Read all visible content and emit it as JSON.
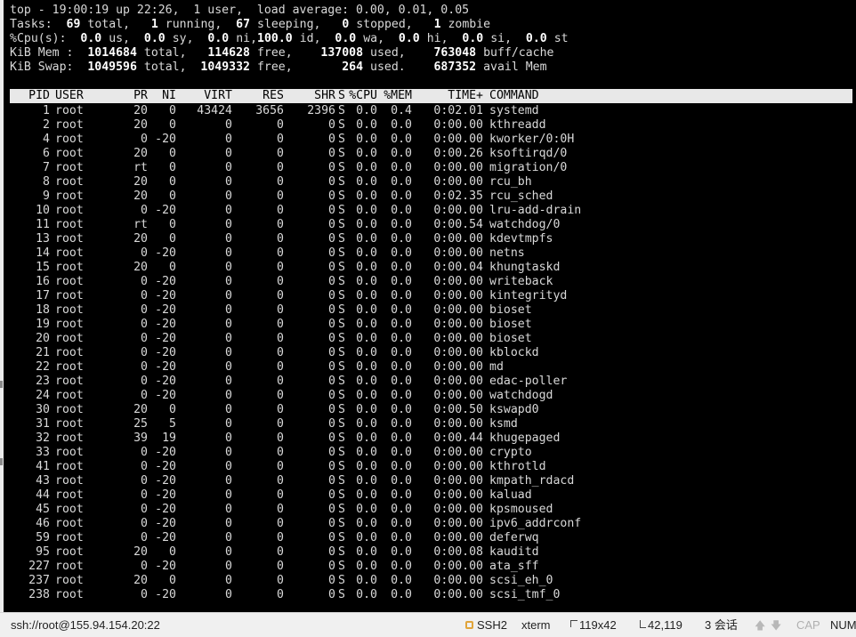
{
  "summary": {
    "line1": "top - 19:00:19 up 22:26,  1 user,  load average: 0.00, 0.01, 0.05",
    "tasks": {
      "label": "Tasks:",
      "total": "69",
      "total_l": "total,",
      "running": "1",
      "running_l": "running,",
      "sleeping": "67",
      "sleeping_l": "sleeping,",
      "stopped": "0",
      "stopped_l": "stopped,",
      "zombie": "1",
      "zombie_l": "zombie"
    },
    "cpu": {
      "label": "%Cpu(s):",
      "us": "0.0",
      "us_l": "us,",
      "sy": "0.0",
      "sy_l": "sy,",
      "ni": "0.0",
      "ni_l": "ni,",
      "id": "100.0",
      "id_l": "id,",
      "wa": "0.0",
      "wa_l": "wa,",
      "hi": "0.0",
      "hi_l": "hi,",
      "si": "0.0",
      "si_l": "si,",
      "st": "0.0",
      "st_l": "st"
    },
    "mem": {
      "label": "KiB Mem :",
      "total": "1014684",
      "total_l": "total,",
      "free": "114628",
      "free_l": "free,",
      "used": "137008",
      "used_l": "used,",
      "buff": "763048",
      "buff_l": "buff/cache"
    },
    "swap": {
      "label": "KiB Swap:",
      "total": "1049596",
      "total_l": "total,",
      "free": "1049332",
      "free_l": "free,",
      "used": "264",
      "used_l": "used.",
      "avail": "687352",
      "avail_l": "avail Mem"
    }
  },
  "columns": {
    "pid": "PID",
    "user": "USER",
    "pr": "PR",
    "ni": "NI",
    "virt": "VIRT",
    "res": "RES",
    "shr": "SHR",
    "s": "S",
    "cpu": "%CPU",
    "mem": "%MEM",
    "time": "TIME+",
    "cmd": "COMMAND"
  },
  "processes": [
    {
      "pid": "1",
      "user": "root",
      "pr": "20",
      "ni": "0",
      "virt": "43424",
      "res": "3656",
      "shr": "2396",
      "s": "S",
      "cpu": "0.0",
      "mem": "0.4",
      "time": "0:02.01",
      "cmd": "systemd"
    },
    {
      "pid": "2",
      "user": "root",
      "pr": "20",
      "ni": "0",
      "virt": "0",
      "res": "0",
      "shr": "0",
      "s": "S",
      "cpu": "0.0",
      "mem": "0.0",
      "time": "0:00.00",
      "cmd": "kthreadd"
    },
    {
      "pid": "4",
      "user": "root",
      "pr": "0",
      "ni": "-20",
      "virt": "0",
      "res": "0",
      "shr": "0",
      "s": "S",
      "cpu": "0.0",
      "mem": "0.0",
      "time": "0:00.00",
      "cmd": "kworker/0:0H"
    },
    {
      "pid": "6",
      "user": "root",
      "pr": "20",
      "ni": "0",
      "virt": "0",
      "res": "0",
      "shr": "0",
      "s": "S",
      "cpu": "0.0",
      "mem": "0.0",
      "time": "0:00.26",
      "cmd": "ksoftirqd/0"
    },
    {
      "pid": "7",
      "user": "root",
      "pr": "rt",
      "ni": "0",
      "virt": "0",
      "res": "0",
      "shr": "0",
      "s": "S",
      "cpu": "0.0",
      "mem": "0.0",
      "time": "0:00.00",
      "cmd": "migration/0"
    },
    {
      "pid": "8",
      "user": "root",
      "pr": "20",
      "ni": "0",
      "virt": "0",
      "res": "0",
      "shr": "0",
      "s": "S",
      "cpu": "0.0",
      "mem": "0.0",
      "time": "0:00.00",
      "cmd": "rcu_bh"
    },
    {
      "pid": "9",
      "user": "root",
      "pr": "20",
      "ni": "0",
      "virt": "0",
      "res": "0",
      "shr": "0",
      "s": "S",
      "cpu": "0.0",
      "mem": "0.0",
      "time": "0:02.35",
      "cmd": "rcu_sched"
    },
    {
      "pid": "10",
      "user": "root",
      "pr": "0",
      "ni": "-20",
      "virt": "0",
      "res": "0",
      "shr": "0",
      "s": "S",
      "cpu": "0.0",
      "mem": "0.0",
      "time": "0:00.00",
      "cmd": "lru-add-drain"
    },
    {
      "pid": "11",
      "user": "root",
      "pr": "rt",
      "ni": "0",
      "virt": "0",
      "res": "0",
      "shr": "0",
      "s": "S",
      "cpu": "0.0",
      "mem": "0.0",
      "time": "0:00.54",
      "cmd": "watchdog/0"
    },
    {
      "pid": "13",
      "user": "root",
      "pr": "20",
      "ni": "0",
      "virt": "0",
      "res": "0",
      "shr": "0",
      "s": "S",
      "cpu": "0.0",
      "mem": "0.0",
      "time": "0:00.00",
      "cmd": "kdevtmpfs"
    },
    {
      "pid": "14",
      "user": "root",
      "pr": "0",
      "ni": "-20",
      "virt": "0",
      "res": "0",
      "shr": "0",
      "s": "S",
      "cpu": "0.0",
      "mem": "0.0",
      "time": "0:00.00",
      "cmd": "netns"
    },
    {
      "pid": "15",
      "user": "root",
      "pr": "20",
      "ni": "0",
      "virt": "0",
      "res": "0",
      "shr": "0",
      "s": "S",
      "cpu": "0.0",
      "mem": "0.0",
      "time": "0:00.04",
      "cmd": "khungtaskd"
    },
    {
      "pid": "16",
      "user": "root",
      "pr": "0",
      "ni": "-20",
      "virt": "0",
      "res": "0",
      "shr": "0",
      "s": "S",
      "cpu": "0.0",
      "mem": "0.0",
      "time": "0:00.00",
      "cmd": "writeback"
    },
    {
      "pid": "17",
      "user": "root",
      "pr": "0",
      "ni": "-20",
      "virt": "0",
      "res": "0",
      "shr": "0",
      "s": "S",
      "cpu": "0.0",
      "mem": "0.0",
      "time": "0:00.00",
      "cmd": "kintegrityd"
    },
    {
      "pid": "18",
      "user": "root",
      "pr": "0",
      "ni": "-20",
      "virt": "0",
      "res": "0",
      "shr": "0",
      "s": "S",
      "cpu": "0.0",
      "mem": "0.0",
      "time": "0:00.00",
      "cmd": "bioset"
    },
    {
      "pid": "19",
      "user": "root",
      "pr": "0",
      "ni": "-20",
      "virt": "0",
      "res": "0",
      "shr": "0",
      "s": "S",
      "cpu": "0.0",
      "mem": "0.0",
      "time": "0:00.00",
      "cmd": "bioset"
    },
    {
      "pid": "20",
      "user": "root",
      "pr": "0",
      "ni": "-20",
      "virt": "0",
      "res": "0",
      "shr": "0",
      "s": "S",
      "cpu": "0.0",
      "mem": "0.0",
      "time": "0:00.00",
      "cmd": "bioset"
    },
    {
      "pid": "21",
      "user": "root",
      "pr": "0",
      "ni": "-20",
      "virt": "0",
      "res": "0",
      "shr": "0",
      "s": "S",
      "cpu": "0.0",
      "mem": "0.0",
      "time": "0:00.00",
      "cmd": "kblockd"
    },
    {
      "pid": "22",
      "user": "root",
      "pr": "0",
      "ni": "-20",
      "virt": "0",
      "res": "0",
      "shr": "0",
      "s": "S",
      "cpu": "0.0",
      "mem": "0.0",
      "time": "0:00.00",
      "cmd": "md"
    },
    {
      "pid": "23",
      "user": "root",
      "pr": "0",
      "ni": "-20",
      "virt": "0",
      "res": "0",
      "shr": "0",
      "s": "S",
      "cpu": "0.0",
      "mem": "0.0",
      "time": "0:00.00",
      "cmd": "edac-poller"
    },
    {
      "pid": "24",
      "user": "root",
      "pr": "0",
      "ni": "-20",
      "virt": "0",
      "res": "0",
      "shr": "0",
      "s": "S",
      "cpu": "0.0",
      "mem": "0.0",
      "time": "0:00.00",
      "cmd": "watchdogd"
    },
    {
      "pid": "30",
      "user": "root",
      "pr": "20",
      "ni": "0",
      "virt": "0",
      "res": "0",
      "shr": "0",
      "s": "S",
      "cpu": "0.0",
      "mem": "0.0",
      "time": "0:00.50",
      "cmd": "kswapd0"
    },
    {
      "pid": "31",
      "user": "root",
      "pr": "25",
      "ni": "5",
      "virt": "0",
      "res": "0",
      "shr": "0",
      "s": "S",
      "cpu": "0.0",
      "mem": "0.0",
      "time": "0:00.00",
      "cmd": "ksmd"
    },
    {
      "pid": "32",
      "user": "root",
      "pr": "39",
      "ni": "19",
      "virt": "0",
      "res": "0",
      "shr": "0",
      "s": "S",
      "cpu": "0.0",
      "mem": "0.0",
      "time": "0:00.44",
      "cmd": "khugepaged"
    },
    {
      "pid": "33",
      "user": "root",
      "pr": "0",
      "ni": "-20",
      "virt": "0",
      "res": "0",
      "shr": "0",
      "s": "S",
      "cpu": "0.0",
      "mem": "0.0",
      "time": "0:00.00",
      "cmd": "crypto"
    },
    {
      "pid": "41",
      "user": "root",
      "pr": "0",
      "ni": "-20",
      "virt": "0",
      "res": "0",
      "shr": "0",
      "s": "S",
      "cpu": "0.0",
      "mem": "0.0",
      "time": "0:00.00",
      "cmd": "kthrotld"
    },
    {
      "pid": "43",
      "user": "root",
      "pr": "0",
      "ni": "-20",
      "virt": "0",
      "res": "0",
      "shr": "0",
      "s": "S",
      "cpu": "0.0",
      "mem": "0.0",
      "time": "0:00.00",
      "cmd": "kmpath_rdacd"
    },
    {
      "pid": "44",
      "user": "root",
      "pr": "0",
      "ni": "-20",
      "virt": "0",
      "res": "0",
      "shr": "0",
      "s": "S",
      "cpu": "0.0",
      "mem": "0.0",
      "time": "0:00.00",
      "cmd": "kaluad"
    },
    {
      "pid": "45",
      "user": "root",
      "pr": "0",
      "ni": "-20",
      "virt": "0",
      "res": "0",
      "shr": "0",
      "s": "S",
      "cpu": "0.0",
      "mem": "0.0",
      "time": "0:00.00",
      "cmd": "kpsmoused"
    },
    {
      "pid": "46",
      "user": "root",
      "pr": "0",
      "ni": "-20",
      "virt": "0",
      "res": "0",
      "shr": "0",
      "s": "S",
      "cpu": "0.0",
      "mem": "0.0",
      "time": "0:00.00",
      "cmd": "ipv6_addrconf"
    },
    {
      "pid": "59",
      "user": "root",
      "pr": "0",
      "ni": "-20",
      "virt": "0",
      "res": "0",
      "shr": "0",
      "s": "S",
      "cpu": "0.0",
      "mem": "0.0",
      "time": "0:00.00",
      "cmd": "deferwq"
    },
    {
      "pid": "95",
      "user": "root",
      "pr": "20",
      "ni": "0",
      "virt": "0",
      "res": "0",
      "shr": "0",
      "s": "S",
      "cpu": "0.0",
      "mem": "0.0",
      "time": "0:00.08",
      "cmd": "kauditd"
    },
    {
      "pid": "227",
      "user": "root",
      "pr": "0",
      "ni": "-20",
      "virt": "0",
      "res": "0",
      "shr": "0",
      "s": "S",
      "cpu": "0.0",
      "mem": "0.0",
      "time": "0:00.00",
      "cmd": "ata_sff"
    },
    {
      "pid": "237",
      "user": "root",
      "pr": "20",
      "ni": "0",
      "virt": "0",
      "res": "0",
      "shr": "0",
      "s": "S",
      "cpu": "0.0",
      "mem": "0.0",
      "time": "0:00.00",
      "cmd": "scsi_eh_0"
    },
    {
      "pid": "238",
      "user": "root",
      "pr": "0",
      "ni": "-20",
      "virt": "0",
      "res": "0",
      "shr": "0",
      "s": "S",
      "cpu": "0.0",
      "mem": "0.0",
      "time": "0:00.00",
      "cmd": "scsi_tmf_0"
    }
  ],
  "statusbar": {
    "connection": "ssh://root@155.94.154.20:22",
    "protocol": "SSH2",
    "terminal_type": "xterm",
    "size": "119x42",
    "cursor": "42,119",
    "sessions": "3 会话",
    "up_arrow": "🡅",
    "down_arrow": "🡇",
    "cap": "CAP",
    "num": "NUM"
  },
  "colors": {
    "terminal_bg": "#000000",
    "terminal_fg": "#d9d9d9",
    "header_bg": "#e8e8e8",
    "statusbar_bg": "#f0f0f0"
  },
  "icons": {
    "lock": "lock-icon",
    "size": "resize-icon",
    "cursor": "cursor-position-icon"
  }
}
